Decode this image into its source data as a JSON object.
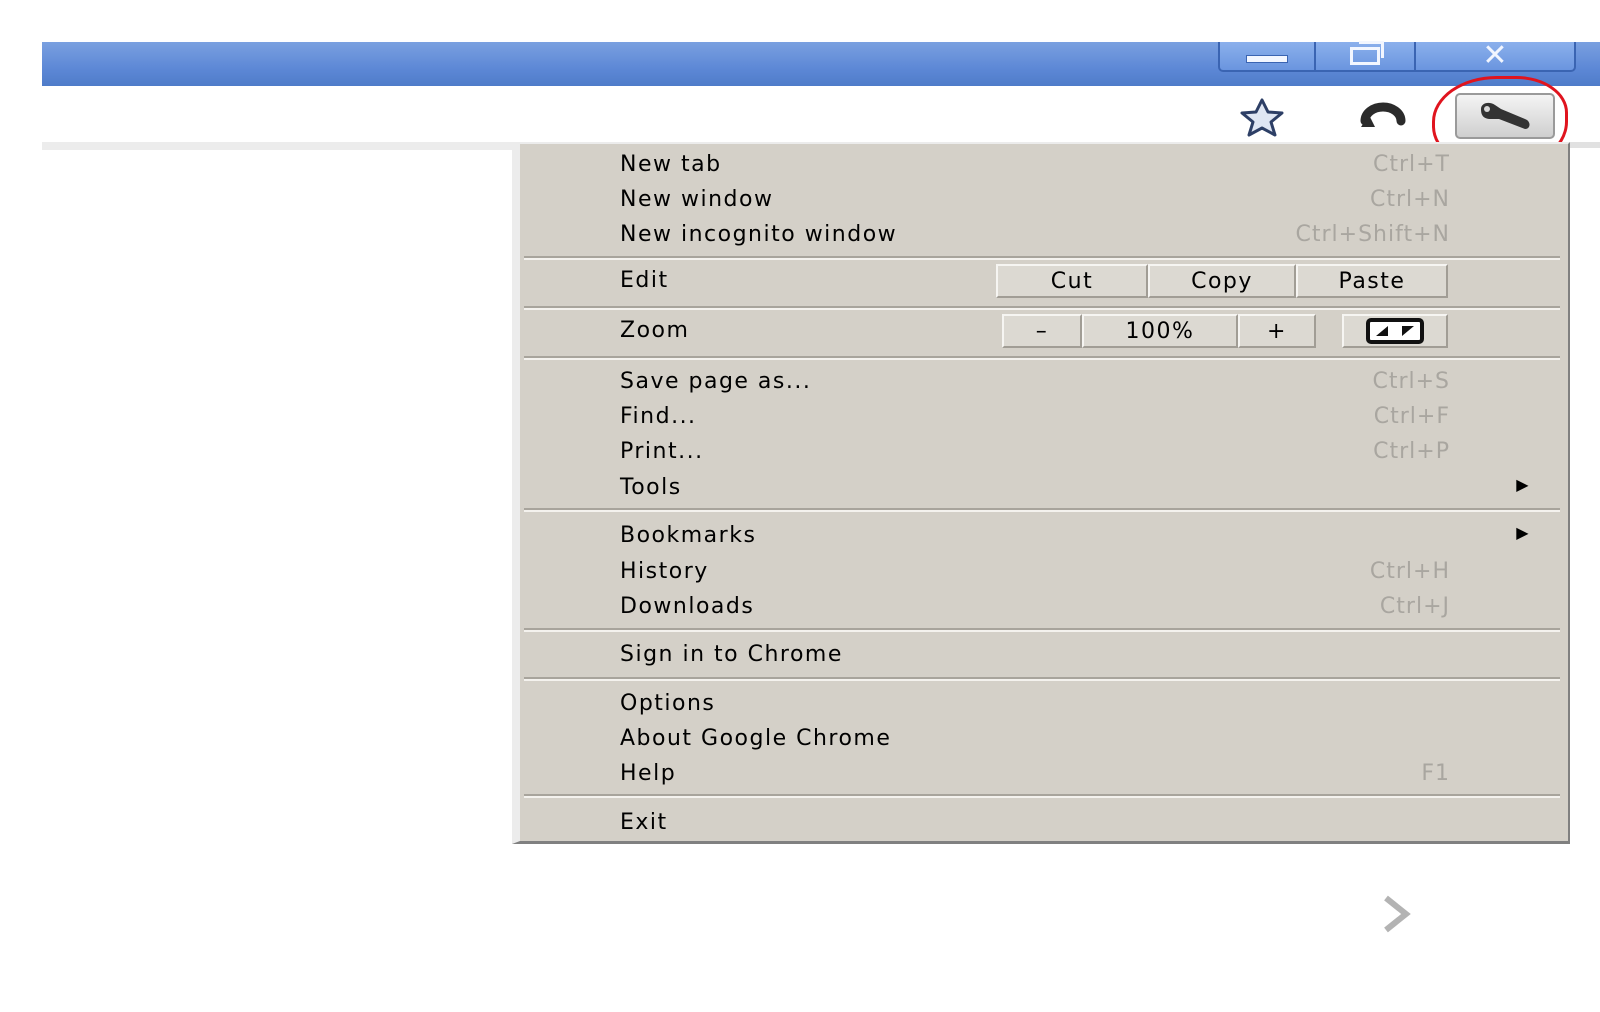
{
  "window": {
    "minimize_icon": "minimize-icon",
    "maximize_icon": "restore-icon",
    "close_icon": "close-icon",
    "titlebar_color": "#5d88d6"
  },
  "toolbar": {
    "star_icon": "star-icon",
    "reload_icon": "reload-icon",
    "wrench_icon": "wrench-icon",
    "highlight_color": "#e0141e"
  },
  "menu": {
    "group1": [
      {
        "label": "New tab",
        "shortcut": "Ctrl+T"
      },
      {
        "label": "New window",
        "shortcut": "Ctrl+N"
      },
      {
        "label": "New incognito window",
        "shortcut": "Ctrl+Shift+N"
      }
    ],
    "edit": {
      "label": "Edit",
      "cut": "Cut",
      "copy": "Copy",
      "paste": "Paste"
    },
    "zoom": {
      "label": "Zoom",
      "minus": "–",
      "value": "100%",
      "plus": "+",
      "fullscreen_icon": "fullscreen-icon"
    },
    "group2": [
      {
        "label": "Save page as...",
        "shortcut": "Ctrl+S"
      },
      {
        "label": "Find...",
        "shortcut": "Ctrl+F"
      },
      {
        "label": "Print...",
        "shortcut": "Ctrl+P"
      },
      {
        "label": "Tools",
        "arrow": "▶"
      }
    ],
    "group3": [
      {
        "label": "Bookmarks",
        "arrow": "▶"
      },
      {
        "label": "History",
        "shortcut": "Ctrl+H"
      },
      {
        "label": "Downloads",
        "shortcut": "Ctrl+J"
      }
    ],
    "signin": {
      "label": "Sign in to Chrome"
    },
    "group4": [
      {
        "label": "Options"
      },
      {
        "label": "About Google Chrome"
      },
      {
        "label": "Help",
        "shortcut": "F1"
      }
    ],
    "exit": {
      "label": "Exit"
    },
    "background_color": "#d4d0c8",
    "shortcut_color": "#a9a6a0"
  },
  "page": {
    "chevron_icon": "chevron-right-icon"
  }
}
